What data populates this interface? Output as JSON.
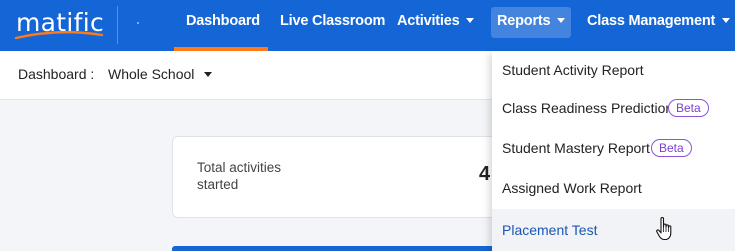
{
  "logo": {
    "text": "matific"
  },
  "nav": {
    "dashboard": "Dashboard",
    "live_classroom": "Live Classroom",
    "activities": "Activities",
    "reports": "Reports",
    "class_management": "Class Management"
  },
  "filter": {
    "label": "Dashboard :",
    "selected": "Whole School"
  },
  "card": {
    "label": "Total activities started",
    "value": "4"
  },
  "reports_menu": {
    "items": [
      {
        "label": "Student Activity Report"
      },
      {
        "label": "Class Readiness Prediction",
        "badge": "Beta"
      },
      {
        "label": "Student Mastery Report",
        "badge": "Beta"
      },
      {
        "label": "Assigned Work Report"
      },
      {
        "label": "Placement Test"
      }
    ]
  },
  "colors": {
    "nav_blue": "#1466d6",
    "active_orange": "#ff7a1a",
    "beta_purple": "#8e52d8",
    "hover_link_blue": "#1a56b4"
  },
  "icons": {
    "nav_caret": "chevron-down-icon",
    "cursor": "hand-pointer-icon"
  }
}
